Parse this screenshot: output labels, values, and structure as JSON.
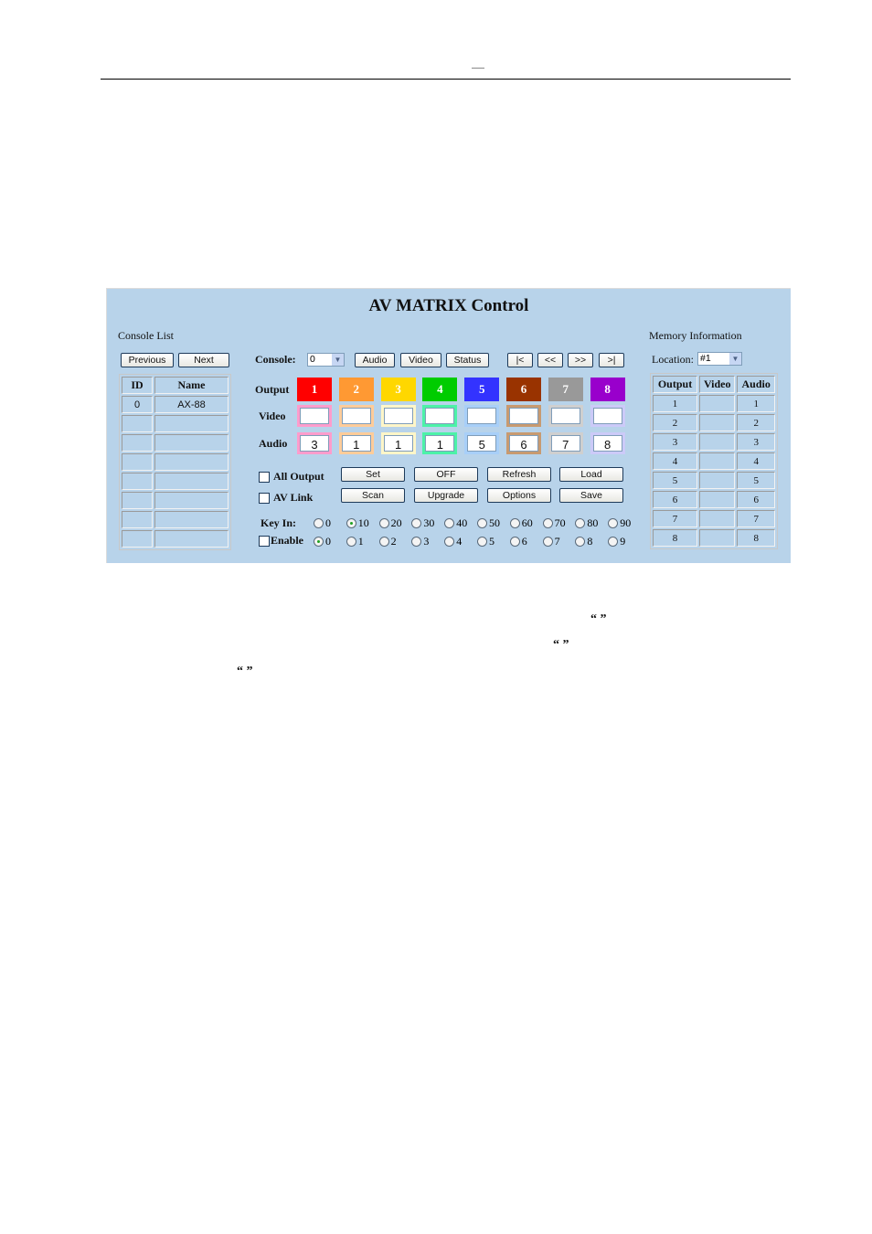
{
  "page": {
    "header_mark": "—",
    "quotes": [
      "“ ”",
      "“ ”",
      "“    ”"
    ]
  },
  "panel": {
    "title": "AV MATRIX Control",
    "console_list": {
      "label": "Console List",
      "previous_label": "Previous",
      "next_label": "Next",
      "headers": [
        "ID",
        "Name"
      ],
      "rows": [
        {
          "id": "0",
          "name": "AX-88"
        },
        {
          "id": "",
          "name": ""
        },
        {
          "id": "",
          "name": ""
        },
        {
          "id": "",
          "name": ""
        },
        {
          "id": "",
          "name": ""
        },
        {
          "id": "",
          "name": ""
        },
        {
          "id": "",
          "name": ""
        },
        {
          "id": "",
          "name": ""
        }
      ]
    },
    "toolbar": {
      "console_label": "Console:",
      "console_value": "0",
      "audio_label": "Audio",
      "video_label": "Video",
      "status_label": "Status",
      "first_label": "|<",
      "prev_label": "<<",
      "next_label": ">>",
      "last_label": ">|"
    },
    "matrix": {
      "output_label": "Output",
      "video_label": "Video",
      "audio_label": "Audio",
      "outputs": [
        {
          "num": "1",
          "color": "#ff0000",
          "edge": "#ff9ccc",
          "video": "",
          "audio": "3"
        },
        {
          "num": "2",
          "color": "#ff9933",
          "edge": "#ffcc99",
          "video": "",
          "audio": "1"
        },
        {
          "num": "3",
          "color": "#ffd700",
          "edge": "#fff6c8",
          "video": "",
          "audio": "1"
        },
        {
          "num": "4",
          "color": "#00cc00",
          "edge": "#4cf2a8",
          "video": "",
          "audio": "1"
        },
        {
          "num": "5",
          "color": "#3333ff",
          "edge": "#a8cff8",
          "video": "",
          "audio": "5"
        },
        {
          "num": "6",
          "color": "#993300",
          "edge": "#c89a70",
          "video": "",
          "audio": "6"
        },
        {
          "num": "7",
          "color": "#999999",
          "edge": "#cfcfcf",
          "video": "",
          "audio": "7"
        },
        {
          "num": "8",
          "color": "#9900cc",
          "edge": "#cccaf8",
          "video": "",
          "audio": "8"
        }
      ]
    },
    "actions": {
      "all_output_label": "All Output",
      "av_link_label": "AV Link",
      "set_label": "Set",
      "off_label": "OFF",
      "refresh_label": "Refresh",
      "load_label": "Load",
      "scan_label": "Scan",
      "upgrade_label": "Upgrade",
      "options_label": "Options",
      "save_label": "Save"
    },
    "keyin": {
      "label": "Key In:",
      "options": [
        "0",
        "10",
        "20",
        "30",
        "40",
        "50",
        "60",
        "70",
        "80",
        "90"
      ],
      "selected": "10",
      "enable_label": "Enable",
      "enable_options": [
        "0",
        "1",
        "2",
        "3",
        "4",
        "5",
        "6",
        "7",
        "8",
        "9"
      ],
      "enable_selected": "0"
    },
    "memory": {
      "label": "Memory Information",
      "location_label": "Location:",
      "location_value": "#1",
      "headers": [
        "Output",
        "Video",
        "Audio"
      ],
      "rows": [
        {
          "output": "1",
          "video": "",
          "audio": "1"
        },
        {
          "output": "2",
          "video": "",
          "audio": "2"
        },
        {
          "output": "3",
          "video": "",
          "audio": "3"
        },
        {
          "output": "4",
          "video": "",
          "audio": "4"
        },
        {
          "output": "5",
          "video": "",
          "audio": "5"
        },
        {
          "output": "6",
          "video": "",
          "audio": "6"
        },
        {
          "output": "7",
          "video": "",
          "audio": "7"
        },
        {
          "output": "8",
          "video": "",
          "audio": "8"
        }
      ]
    }
  }
}
